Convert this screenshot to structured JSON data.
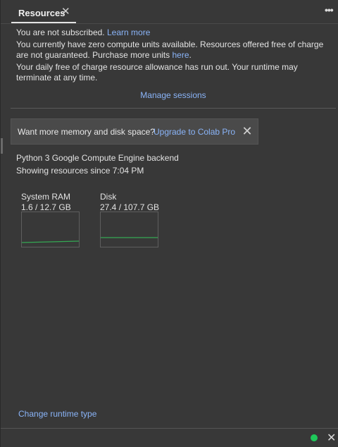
{
  "tab": {
    "label": "Resources",
    "close_glyph": "✕"
  },
  "header": {
    "more_glyph": "•••"
  },
  "notices": {
    "subscription": "You are not subscribed.",
    "learn_more": "Learn more",
    "units": "You currently have zero compute units available. Resources offered free of charge are not guaranteed. Purchase more units",
    "units_link": "here",
    "units_end": ".",
    "allowance": "Your daily free of charge resource allowance has run out. Your runtime may terminate at any time."
  },
  "manage_sessions": "Manage sessions",
  "banner": {
    "text": "Want more memory and disk space?",
    "link": "Upgrade to Colab Pro",
    "close_glyph": "✕"
  },
  "backend": {
    "name": "Python 3 Google Compute Engine backend",
    "since": "Showing resources since 7:04 PM"
  },
  "metrics": {
    "ram": {
      "label": "System RAM",
      "value": "1.6 / 12.7 GB",
      "used": 1.6,
      "total": 12.7
    },
    "disk": {
      "label": "Disk",
      "value": "27.4 / 107.7 GB",
      "used": 27.4,
      "total": 107.7
    }
  },
  "change_runtime": "Change runtime type",
  "status": {
    "close_glyph": "✕"
  },
  "colors": {
    "accent": "#8ab4f8",
    "graph_line": "#34a853",
    "status_ok": "#1ec95a",
    "background": "#383838"
  }
}
